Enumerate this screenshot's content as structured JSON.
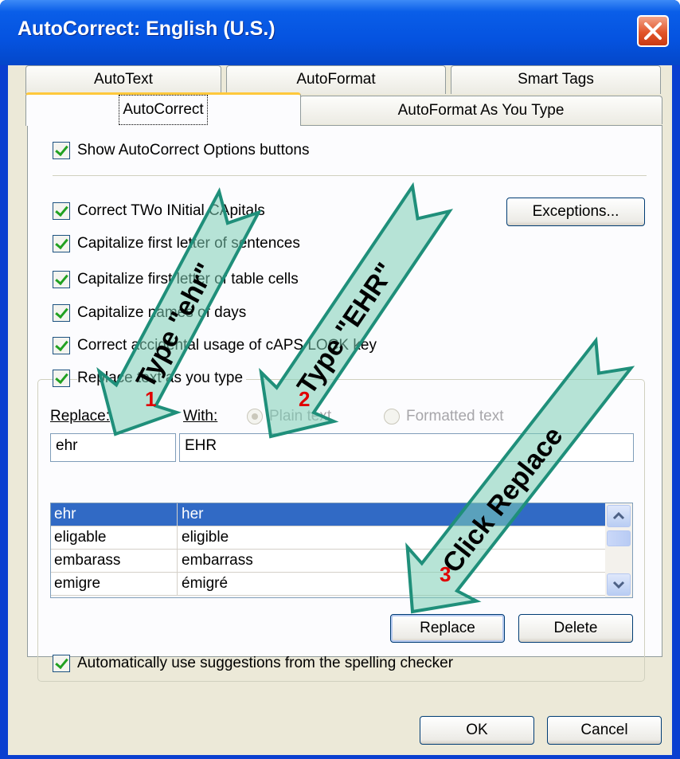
{
  "window": {
    "title": "AutoCorrect: English (U.S.)"
  },
  "tabs": {
    "row_back": [
      "AutoText",
      "AutoFormat",
      "Smart Tags"
    ],
    "row_front": [
      "AutoCorrect",
      "AutoFormat As You Type"
    ],
    "active": "AutoCorrect"
  },
  "options": {
    "show_buttons": "Show AutoCorrect Options buttons",
    "two_initial_caps": "Correct TWo INitial CApitals",
    "first_letter_sentences": "Capitalize first letter of sentences",
    "first_letter_cells": "Capitalize first letter of table cells",
    "names_of_days": "Capitalize names of days",
    "caps_lock": "Correct accidental usage of cAPS LOCK key",
    "replace_as_type": "Replace text as you type",
    "use_suggestions": "Automatically use suggestions from the spelling checker"
  },
  "buttons": {
    "exceptions": "Exceptions...",
    "replace": "Replace",
    "delete": "Delete",
    "ok": "OK",
    "cancel": "Cancel"
  },
  "replace_section": {
    "replace_label": "Replace:",
    "with_label": "With:",
    "plain_text": "Plain text",
    "formatted_text": "Formatted text",
    "replace_value": "ehr",
    "with_value": "EHR"
  },
  "entries": [
    {
      "from": "ehr",
      "to": "her",
      "selected": true
    },
    {
      "from": "eligable",
      "to": "eligible",
      "selected": false
    },
    {
      "from": "embarass",
      "to": "embarrass",
      "selected": false
    },
    {
      "from": "emigre",
      "to": "émigré",
      "selected": false
    }
  ],
  "annotations": {
    "arrow1_text": "Type \"ehr\"",
    "arrow1_num": "1",
    "arrow2_text": "Type \"EHR\"",
    "arrow2_num": "2",
    "arrow3_text": "Click Replace",
    "arrow3_num": "3",
    "arrow_color": "#1f8f7a"
  }
}
